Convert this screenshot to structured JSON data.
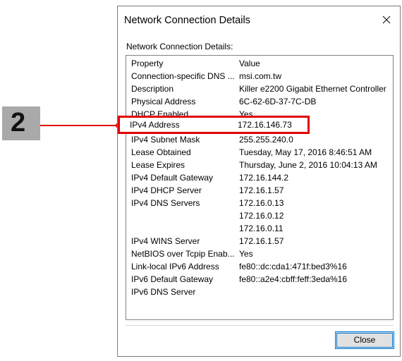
{
  "callout": {
    "step_number": "2",
    "line_color": "#e00000",
    "badge_color": "#a9a9a9"
  },
  "dialog": {
    "title": "Network Connection Details",
    "content_label": "Network Connection Details:",
    "close_icon": "close-icon",
    "close_button_label": "Close"
  },
  "list": {
    "header": {
      "property": "Property",
      "value": "Value"
    },
    "rows": [
      {
        "property": "Connection-specific DNS ...",
        "value": "msi.com.tw"
      },
      {
        "property": "Description",
        "value": "Killer e2200 Gigabit Ethernet Controller"
      },
      {
        "property": "Physical Address",
        "value": "6C-62-6D-37-7C-DB"
      },
      {
        "property": "DHCP Enabled",
        "value": "Yes"
      },
      {
        "property": "IPv4 Address",
        "value": "172.16.146.73"
      },
      {
        "property": "IPv4 Subnet Mask",
        "value": "255.255.240.0"
      },
      {
        "property": "Lease Obtained",
        "value": "Tuesday, May 17, 2016 8:46:51 AM"
      },
      {
        "property": "Lease Expires",
        "value": "Thursday, June 2, 2016 10:04:13 AM"
      },
      {
        "property": "IPv4 Default Gateway",
        "value": "172.16.144.2"
      },
      {
        "property": "IPv4 DHCP Server",
        "value": "172.16.1.57"
      },
      {
        "property": "IPv4 DNS Servers",
        "value": "172.16.0.13"
      },
      {
        "property": "",
        "value": "172.16.0.12"
      },
      {
        "property": "",
        "value": "172.16.0.11"
      },
      {
        "property": "IPv4 WINS Server",
        "value": "172.16.1.57"
      },
      {
        "property": "NetBIOS over Tcpip Enab...",
        "value": "Yes"
      },
      {
        "property": "Link-local IPv6 Address",
        "value": "fe80::dc:cda1:471f:bed3%16"
      },
      {
        "property": "IPv6 Default Gateway",
        "value": "fe80::a2e4:cbff:feff:3eda%16"
      },
      {
        "property": "IPv6 DNS Server",
        "value": ""
      }
    ]
  }
}
